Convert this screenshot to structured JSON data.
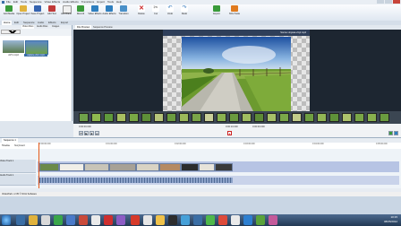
{
  "menubar": {
    "items": [
      "File",
      "Edit",
      "Tools",
      "Sequence",
      "Video Effects",
      "Audio Effects",
      "Transitions",
      "Export",
      "Tools",
      "Help"
    ]
  },
  "ribbon": {
    "buttons": [
      {
        "label": "Add Media",
        "icon": "add-media-icon",
        "color": "#3a9b3a"
      },
      {
        "label": "Open Project",
        "icon": "folder-icon",
        "color": "#e0b23c"
      },
      {
        "label": "Save Project",
        "icon": "save-icon",
        "color": "#3563b0"
      },
      {
        "label": "Add Text",
        "icon": "text-icon",
        "color": "#c03a3a"
      },
      {
        "label": "Add Blank",
        "icon": "blank-icon",
        "color": "#f0f0f0"
      },
      {
        "label": "Record",
        "icon": "record-icon",
        "color": "#3a9b3a"
      },
      {
        "label": "Video Effects",
        "icon": "video-fx-icon",
        "color": "#2f7fbf"
      },
      {
        "label": "Audio Effects",
        "icon": "audio-fx-icon",
        "color": "#2f7fbf"
      },
      {
        "label": "Transition",
        "icon": "transition-icon",
        "color": "#4a90c8"
      },
      {
        "label": "Delete",
        "icon": "delete-icon",
        "color": "#cc2222"
      },
      {
        "label": "Cut",
        "icon": "scissors-icon",
        "color": "#555555"
      },
      {
        "label": "Undo",
        "icon": "undo-icon",
        "color": "#3b7ec0"
      },
      {
        "label": "Redo",
        "icon": "redo-icon",
        "color": "#3b7ec0"
      },
      {
        "label": "Export",
        "icon": "export-icon",
        "color": "#3a9b3a"
      },
      {
        "label": "NCH Suite",
        "icon": "nch-icon",
        "color": "#e07b1f"
      }
    ]
  },
  "tabs": [
    "Home",
    "Edit",
    "Sequence",
    "Audio",
    "Effects",
    "Export"
  ],
  "left_panel": {
    "tabs": [
      "Video Files",
      "Audio Files",
      "Images"
    ],
    "sequence_select": "Sequence 1",
    "files": [
      "vid*-1.mp4",
      "capture-vid-1.mp4"
    ]
  },
  "preview": {
    "tabs": [
      "File Preview",
      "Sequence Preview"
    ],
    "clip_title": "Sonne vinyasa vinyl.mp4",
    "time_left": "0:00:00.000",
    "time_right": "0:00:00.000",
    "time_mid": "0:00:10.000"
  },
  "timeline": {
    "sequence_tab": "Sequence 1",
    "view_tabs": [
      "Timeline",
      "Storyboard"
    ],
    "ruler": [
      "0:00:00.000",
      "0:01:00.000",
      "0:02:00.000",
      "0:03:00.000",
      "0:04:00.000",
      "0:05:00.000"
    ],
    "tracks": [
      "Video Track 1",
      "Audio Track 1"
    ]
  },
  "status": {
    "text": "VideoPad v 2.35 © NCH Software"
  },
  "taskbar": {
    "time": "10:15",
    "date": "08/05/2012"
  }
}
